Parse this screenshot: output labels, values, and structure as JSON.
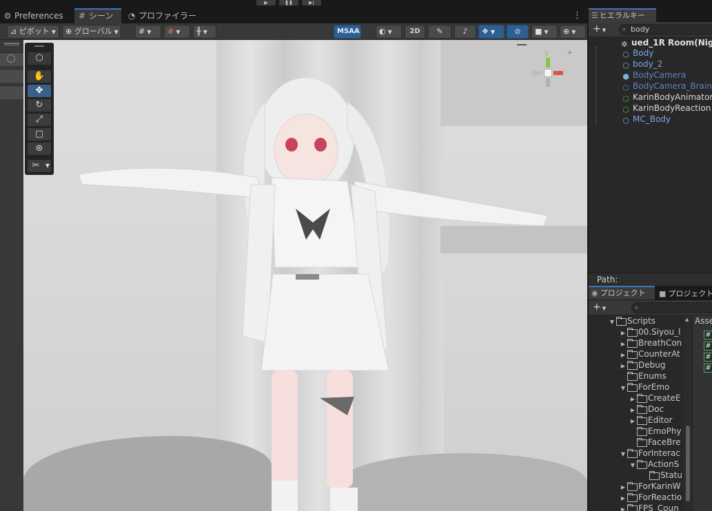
{
  "topbar": {
    "play_icon": "play-icon",
    "pause_icon": "pause-icon",
    "step_icon": "step-icon"
  },
  "tabs": [
    {
      "label": "Preferences",
      "icon": "gear-icon"
    },
    {
      "label": "シーン",
      "icon": "grid-icon"
    },
    {
      "label": "プロファイラー",
      "icon": "profiler-icon"
    }
  ],
  "scene_toolbar": {
    "pivot": "ピボット",
    "global": "グローバル",
    "msaa": "MSAA",
    "mode_2d": "2D"
  },
  "hierarchy": {
    "tab": "ヒエラルキー",
    "search_value": "body",
    "scene_root": "ued_1R Room(Nig",
    "items": [
      {
        "label": "Body",
        "color": "#7ca7e6",
        "icon": "prefab-cube-icon"
      },
      {
        "label": "body_2",
        "color": "#7ca7e6",
        "icon": "prefab-cube-icon"
      },
      {
        "label": "BodyCamera",
        "color": "#5c83bf",
        "icon": "prefab-cube-icon"
      },
      {
        "label": "BodyCamera_Brain_",
        "color": "#5c83bf",
        "icon": "prefab-cube-icon"
      },
      {
        "label": "KarinBodyAnimator",
        "color": "#d8d8d8",
        "icon": "script-cube-icon"
      },
      {
        "label": "KarinBodyReaction",
        "color": "#d8d8d8",
        "icon": "script-cube-icon"
      },
      {
        "label": "MC_Body",
        "color": "#7ca7e6",
        "icon": "prefab-cube-icon"
      }
    ],
    "path_label": "Path:"
  },
  "project": {
    "tab1": "プロジェクト",
    "tab2": "プロジェクト",
    "assets_label": "Asse",
    "tree": [
      {
        "label": "Scripts",
        "indent": 0,
        "expanded": true
      },
      {
        "label": "00.Siyou_l",
        "indent": 1,
        "expanded": false
      },
      {
        "label": "BreathCon",
        "indent": 1,
        "expanded": false,
        "asm": true
      },
      {
        "label": "CounterAt",
        "indent": 1,
        "expanded": false,
        "asm": true
      },
      {
        "label": "Debug",
        "indent": 1,
        "expanded": false,
        "asm": true
      },
      {
        "label": "Enums",
        "indent": 1,
        "expanded": false,
        "asm": true
      },
      {
        "label": "ForEmo",
        "indent": 1,
        "expanded": true,
        "asm": true
      },
      {
        "label": "CreateE",
        "indent": 2,
        "expanded": false
      },
      {
        "label": "Doc",
        "indent": 2,
        "expanded": false
      },
      {
        "label": "Editor",
        "indent": 2,
        "expanded": false,
        "asm": true
      },
      {
        "label": "EmoPhy",
        "indent": 2,
        "expanded": false
      },
      {
        "label": "FaceBre",
        "indent": 2,
        "expanded": false
      },
      {
        "label": "ForInterac",
        "indent": 1,
        "expanded": true
      },
      {
        "label": "ActionS",
        "indent": 2,
        "expanded": true
      },
      {
        "label": "Statu",
        "indent": 3,
        "expanded": false,
        "leaf": true
      },
      {
        "label": "ForKarinW",
        "indent": 1,
        "expanded": false
      },
      {
        "label": "ForReactio",
        "indent": 1,
        "expanded": false
      },
      {
        "label": "FPS_Coun",
        "indent": 1,
        "expanded": false
      }
    ]
  }
}
